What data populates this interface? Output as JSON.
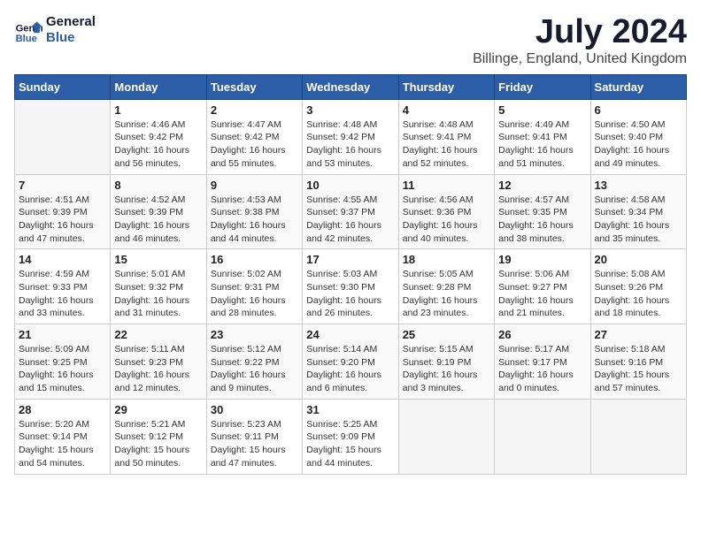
{
  "logo": {
    "line1": "General",
    "line2": "Blue"
  },
  "title": "July 2024",
  "location": "Billinge, England, United Kingdom",
  "days_of_week": [
    "Sunday",
    "Monday",
    "Tuesday",
    "Wednesday",
    "Thursday",
    "Friday",
    "Saturday"
  ],
  "weeks": [
    [
      {
        "day": "",
        "info": ""
      },
      {
        "day": "1",
        "info": "Sunrise: 4:46 AM\nSunset: 9:42 PM\nDaylight: 16 hours\nand 56 minutes."
      },
      {
        "day": "2",
        "info": "Sunrise: 4:47 AM\nSunset: 9:42 PM\nDaylight: 16 hours\nand 55 minutes."
      },
      {
        "day": "3",
        "info": "Sunrise: 4:48 AM\nSunset: 9:42 PM\nDaylight: 16 hours\nand 53 minutes."
      },
      {
        "day": "4",
        "info": "Sunrise: 4:48 AM\nSunset: 9:41 PM\nDaylight: 16 hours\nand 52 minutes."
      },
      {
        "day": "5",
        "info": "Sunrise: 4:49 AM\nSunset: 9:41 PM\nDaylight: 16 hours\nand 51 minutes."
      },
      {
        "day": "6",
        "info": "Sunrise: 4:50 AM\nSunset: 9:40 PM\nDaylight: 16 hours\nand 49 minutes."
      }
    ],
    [
      {
        "day": "7",
        "info": "Sunrise: 4:51 AM\nSunset: 9:39 PM\nDaylight: 16 hours\nand 47 minutes."
      },
      {
        "day": "8",
        "info": "Sunrise: 4:52 AM\nSunset: 9:39 PM\nDaylight: 16 hours\nand 46 minutes."
      },
      {
        "day": "9",
        "info": "Sunrise: 4:53 AM\nSunset: 9:38 PM\nDaylight: 16 hours\nand 44 minutes."
      },
      {
        "day": "10",
        "info": "Sunrise: 4:55 AM\nSunset: 9:37 PM\nDaylight: 16 hours\nand 42 minutes."
      },
      {
        "day": "11",
        "info": "Sunrise: 4:56 AM\nSunset: 9:36 PM\nDaylight: 16 hours\nand 40 minutes."
      },
      {
        "day": "12",
        "info": "Sunrise: 4:57 AM\nSunset: 9:35 PM\nDaylight: 16 hours\nand 38 minutes."
      },
      {
        "day": "13",
        "info": "Sunrise: 4:58 AM\nSunset: 9:34 PM\nDaylight: 16 hours\nand 35 minutes."
      }
    ],
    [
      {
        "day": "14",
        "info": "Sunrise: 4:59 AM\nSunset: 9:33 PM\nDaylight: 16 hours\nand 33 minutes."
      },
      {
        "day": "15",
        "info": "Sunrise: 5:01 AM\nSunset: 9:32 PM\nDaylight: 16 hours\nand 31 minutes."
      },
      {
        "day": "16",
        "info": "Sunrise: 5:02 AM\nSunset: 9:31 PM\nDaylight: 16 hours\nand 28 minutes."
      },
      {
        "day": "17",
        "info": "Sunrise: 5:03 AM\nSunset: 9:30 PM\nDaylight: 16 hours\nand 26 minutes."
      },
      {
        "day": "18",
        "info": "Sunrise: 5:05 AM\nSunset: 9:28 PM\nDaylight: 16 hours\nand 23 minutes."
      },
      {
        "day": "19",
        "info": "Sunrise: 5:06 AM\nSunset: 9:27 PM\nDaylight: 16 hours\nand 21 minutes."
      },
      {
        "day": "20",
        "info": "Sunrise: 5:08 AM\nSunset: 9:26 PM\nDaylight: 16 hours\nand 18 minutes."
      }
    ],
    [
      {
        "day": "21",
        "info": "Sunrise: 5:09 AM\nSunset: 9:25 PM\nDaylight: 16 hours\nand 15 minutes."
      },
      {
        "day": "22",
        "info": "Sunrise: 5:11 AM\nSunset: 9:23 PM\nDaylight: 16 hours\nand 12 minutes."
      },
      {
        "day": "23",
        "info": "Sunrise: 5:12 AM\nSunset: 9:22 PM\nDaylight: 16 hours\nand 9 minutes."
      },
      {
        "day": "24",
        "info": "Sunrise: 5:14 AM\nSunset: 9:20 PM\nDaylight: 16 hours\nand 6 minutes."
      },
      {
        "day": "25",
        "info": "Sunrise: 5:15 AM\nSunset: 9:19 PM\nDaylight: 16 hours\nand 3 minutes."
      },
      {
        "day": "26",
        "info": "Sunrise: 5:17 AM\nSunset: 9:17 PM\nDaylight: 16 hours\nand 0 minutes."
      },
      {
        "day": "27",
        "info": "Sunrise: 5:18 AM\nSunset: 9:16 PM\nDaylight: 15 hours\nand 57 minutes."
      }
    ],
    [
      {
        "day": "28",
        "info": "Sunrise: 5:20 AM\nSunset: 9:14 PM\nDaylight: 15 hours\nand 54 minutes."
      },
      {
        "day": "29",
        "info": "Sunrise: 5:21 AM\nSunset: 9:12 PM\nDaylight: 15 hours\nand 50 minutes."
      },
      {
        "day": "30",
        "info": "Sunrise: 5:23 AM\nSunset: 9:11 PM\nDaylight: 15 hours\nand 47 minutes."
      },
      {
        "day": "31",
        "info": "Sunrise: 5:25 AM\nSunset: 9:09 PM\nDaylight: 15 hours\nand 44 minutes."
      },
      {
        "day": "",
        "info": ""
      },
      {
        "day": "",
        "info": ""
      },
      {
        "day": "",
        "info": ""
      }
    ]
  ]
}
